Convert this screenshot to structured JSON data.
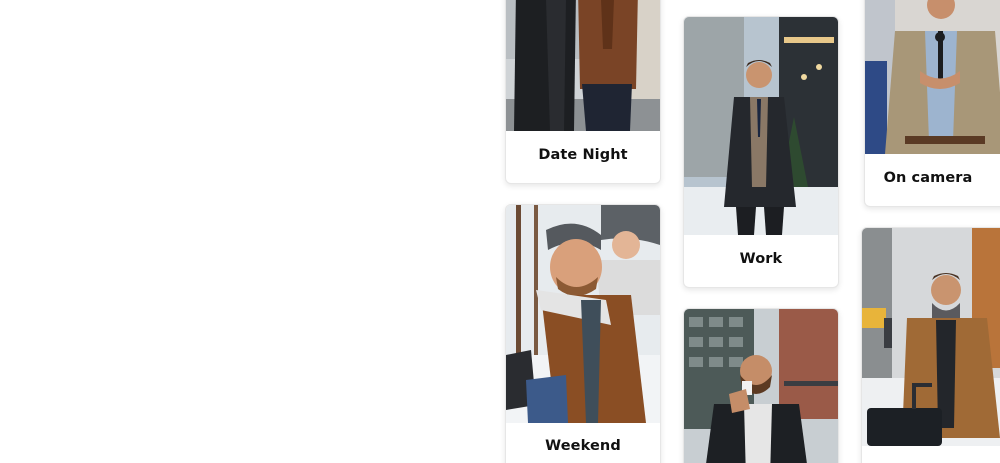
{
  "cards": [
    {
      "label": "Date Night",
      "image": "couple in winter coats on a snowy street"
    },
    {
      "label": "Work",
      "image": "man in a dark overcoat, vest and tie walking on a snowy city street"
    },
    {
      "label": "On camera",
      "image": "man in a beige blazer speaking into a microphone"
    },
    {
      "label": "Weekend",
      "image": "smiling couple in beanies, piggyback ride in the snow"
    },
    {
      "label": "",
      "image": "man in a black jacket drinking coffee by modern buildings"
    },
    {
      "label": "",
      "image": "man in a camel coat with a suitcase on a snowy city street"
    }
  ],
  "colors": {
    "background": "#ffffff",
    "card_border": "#e6e6e6",
    "label_text": "#111111"
  }
}
